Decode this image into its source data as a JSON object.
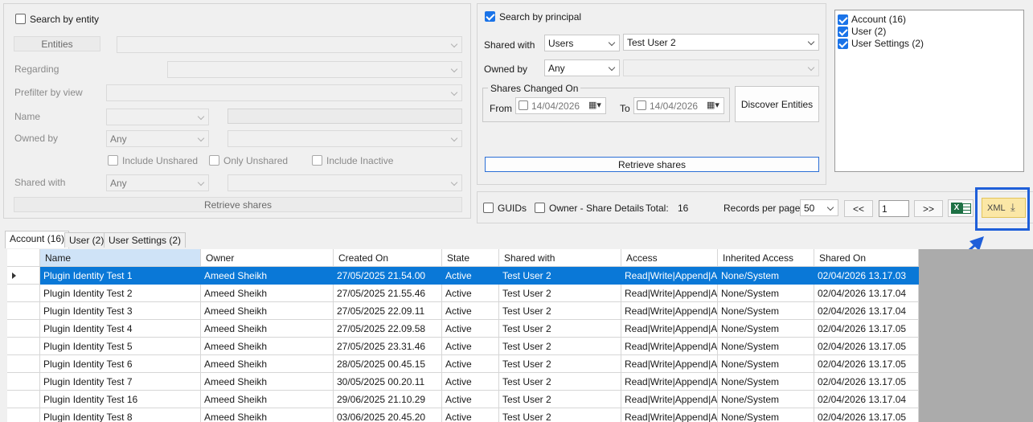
{
  "entity_panel": {
    "search_by_entity": "Search by entity",
    "entities_button": "Entities",
    "regarding": "Regarding",
    "prefilter": "Prefilter by view",
    "name": "Name",
    "owned_by": "Owned by",
    "owned_by_value": "Any",
    "include_unshared": "Include Unshared",
    "only_unshared": "Only Unshared",
    "include_inactive": "Include Inactive",
    "shared_with": "Shared with",
    "shared_with_value": "Any",
    "retrieve_button": "Retrieve shares"
  },
  "principal_panel": {
    "search_by_principal": "Search by principal",
    "shared_with": "Shared with",
    "shared_with_type": "Users",
    "shared_with_user": "Test User 2",
    "owned_by": "Owned by",
    "owned_by_value": "Any",
    "shares_changed_on": "Shares Changed On",
    "from": "From",
    "to": "To",
    "from_date": "14/04/2026",
    "to_date": "14/04/2026",
    "discover_button": "Discover Entities",
    "retrieve_button": "Retrieve shares"
  },
  "entity_list": [
    {
      "label": "Account (16)",
      "checked": true
    },
    {
      "label": "User (2)",
      "checked": true
    },
    {
      "label": "User Settings (2)",
      "checked": true
    }
  ],
  "toolbar": {
    "guids": "GUIDs",
    "owner_share_details": "Owner - Share Details",
    "total_label": "Total:",
    "total_value": "16",
    "records_per_page": "Records per page",
    "records_value": "50",
    "prev": "<<",
    "page": "1",
    "next": ">>",
    "excel_icon": "X",
    "xml_label": "XML"
  },
  "tabs": [
    "Account (16)",
    "User (2)",
    "User Settings (2)"
  ],
  "grid": {
    "columns": [
      "Name",
      "Owner",
      "Created On",
      "State",
      "Shared with",
      "Access",
      "Inherited Access",
      "Shared On"
    ],
    "rows": [
      [
        "Plugin Identity Test 1",
        "Ameed Sheikh",
        "27/05/2025 21.54.00",
        "Active",
        "Test User 2",
        "Read|Write|Append|A...",
        "None/System",
        "02/04/2026 13.17.03"
      ],
      [
        "Plugin Identity Test 2",
        "Ameed Sheikh",
        "27/05/2025 21.55.46",
        "Active",
        "Test User 2",
        "Read|Write|Append|A...",
        "None/System",
        "02/04/2026 13.17.04"
      ],
      [
        "Plugin Identity Test 3",
        "Ameed Sheikh",
        "27/05/2025 22.09.11",
        "Active",
        "Test User 2",
        "Read|Write|Append|A...",
        "None/System",
        "02/04/2026 13.17.04"
      ],
      [
        "Plugin Identity Test 4",
        "Ameed Sheikh",
        "27/05/2025 22.09.58",
        "Active",
        "Test User 2",
        "Read|Write|Append|A...",
        "None/System",
        "02/04/2026 13.17.05"
      ],
      [
        "Plugin Identity Test 5",
        "Ameed Sheikh",
        "27/05/2025 23.31.46",
        "Active",
        "Test User 2",
        "Read|Write|Append|A...",
        "None/System",
        "02/04/2026 13.17.05"
      ],
      [
        "Plugin Identity Test 6",
        "Ameed Sheikh",
        "28/05/2025 00.45.15",
        "Active",
        "Test User 2",
        "Read|Write|Append|A...",
        "None/System",
        "02/04/2026 13.17.05"
      ],
      [
        "Plugin Identity Test 7",
        "Ameed Sheikh",
        "30/05/2025 00.20.11",
        "Active",
        "Test User 2",
        "Read|Write|Append|A...",
        "None/System",
        "02/04/2026 13.17.05"
      ],
      [
        "Plugin Identity Test 16",
        "Ameed Sheikh",
        "29/06/2025 21.10.29",
        "Active",
        "Test User 2",
        "Read|Write|Append|A...",
        "None/System",
        "02/04/2026 13.17.04"
      ],
      [
        "Plugin Identity Test 8",
        "Ameed Sheikh",
        "03/06/2025 20.45.20",
        "Active",
        "Test User 2",
        "Read|Write|Append|A...",
        "None/System",
        "02/04/2026 13.17.05"
      ]
    ]
  },
  "colors": {
    "accent": "#1a73e8",
    "selection": "#0a78d7",
    "highlight_box": "#1f5fd9",
    "xml_button": "#fbe7a6"
  }
}
